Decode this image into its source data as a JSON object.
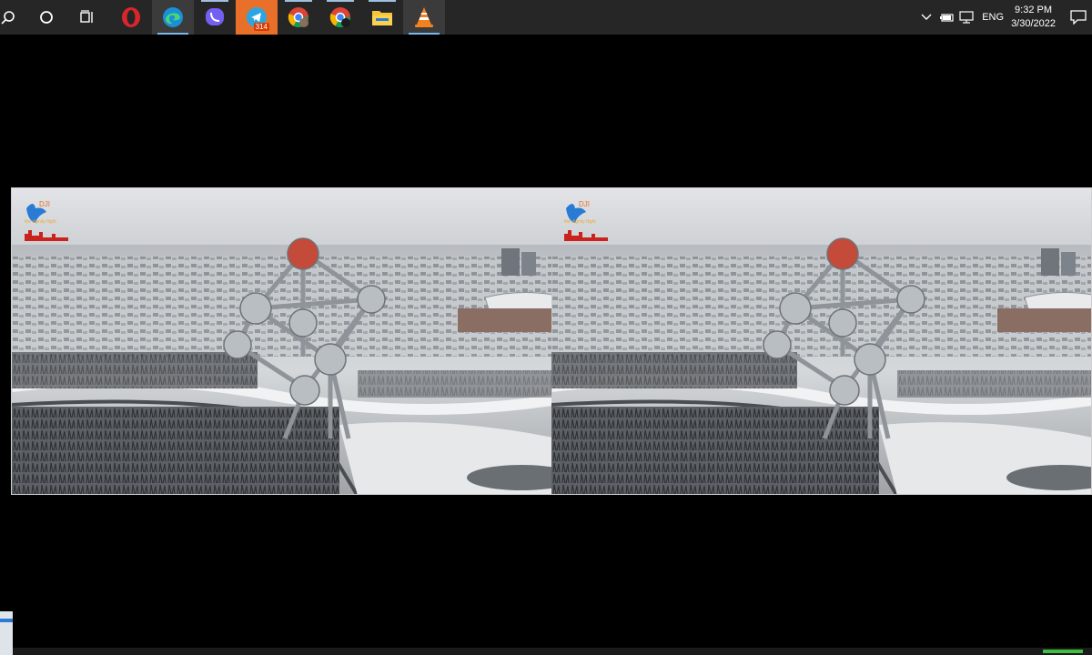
{
  "taskbar": {
    "apps": [
      {
        "name": "search-icon",
        "state": ""
      },
      {
        "name": "cortana-icon",
        "state": ""
      },
      {
        "name": "task-view-icon",
        "state": ""
      },
      {
        "name": "opera-icon",
        "state": ""
      },
      {
        "name": "edge-icon",
        "state": "active"
      },
      {
        "name": "viber-icon",
        "state": "open"
      },
      {
        "name": "telegram-icon",
        "state": "orange",
        "badge": "314"
      },
      {
        "name": "chrome-profile-1-icon",
        "state": "open"
      },
      {
        "name": "chrome-profile-2-icon",
        "state": "open"
      },
      {
        "name": "file-explorer-icon",
        "state": "open"
      },
      {
        "name": "vlc-icon",
        "state": "active"
      }
    ],
    "tray": {
      "language": "ENG",
      "time": "9:32 PM",
      "date": "3/30/2022"
    }
  },
  "video": {
    "logo_text": "the dignity flight",
    "logo_accent": "DJI",
    "scene": "atomium-snow-aerial"
  },
  "colors": {
    "taskbar_bg": "#262626",
    "accent": "#76b9ed",
    "telegram": "#e8702a"
  }
}
